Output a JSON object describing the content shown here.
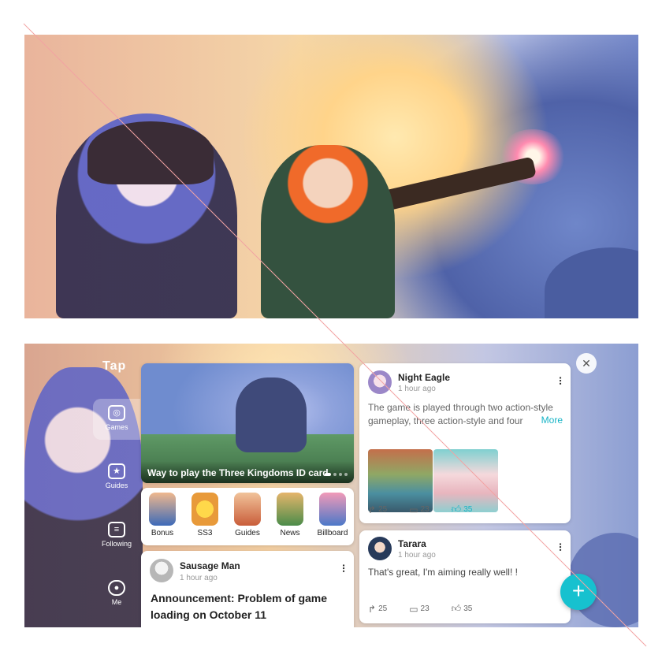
{
  "colors": {
    "accent": "#16b4c6",
    "fab": "#17c1cf",
    "text": "#222222",
    "muted": "#999999"
  },
  "logo": "Tap",
  "sidebar": {
    "items": [
      {
        "label": "Games",
        "icon": "gamepad-icon"
      },
      {
        "label": "Guides",
        "icon": "star-card-icon"
      },
      {
        "label": "Following",
        "icon": "feed-icon"
      },
      {
        "label": "Me",
        "icon": "person-icon"
      }
    ]
  },
  "banner": {
    "title": "Way to play the Three Kingdoms ID card"
  },
  "quick_links": [
    {
      "label": "Bonus"
    },
    {
      "label": "SS3"
    },
    {
      "label": "Guides"
    },
    {
      "label": "News"
    },
    {
      "label": "Billboard"
    }
  ],
  "post_left": {
    "user": "Sausage Man",
    "time": "1 hour ago",
    "headline": "Announcement: Problem of game loading on October 11"
  },
  "post_right_1": {
    "user": "Night Eagle",
    "time": "1 hour ago",
    "text": "The game is played through two action-style gameplay, three action-style and four",
    "more": "More",
    "shares": "25",
    "comments": "23",
    "likes": "35"
  },
  "post_right_2": {
    "user": "Tarara",
    "time": "1 hour ago",
    "text": "That's great, I'm aiming really well! !",
    "shares": "25",
    "comments": "23",
    "likes": "35"
  },
  "close_symbol": "✕",
  "fab_symbol": "+"
}
